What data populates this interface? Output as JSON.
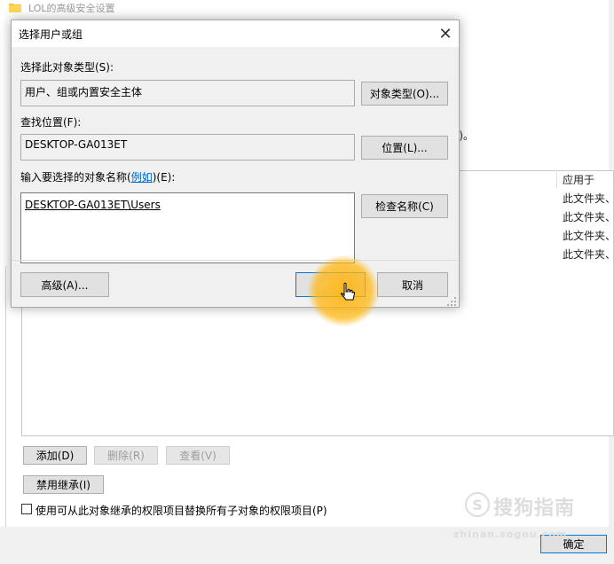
{
  "background_window": {
    "title": "LOL的高级安全设置",
    "fragment_text": "i)。",
    "list_column_header": "应用于",
    "list_rows": [
      "此文件夹、",
      "此文件夹、",
      "此文件夹、",
      "此文件夹、"
    ],
    "buttons": {
      "add": "添加(D)",
      "remove": "删除(R)",
      "view": "查看(V)",
      "disable_inheritance": "禁用继承(I)"
    },
    "replace_checkbox_label": "使用可从此对象继承的权限项目替换所有子对象的权限项目(P)",
    "ok": "确定"
  },
  "dialog": {
    "title": "选择用户或组",
    "close_glyph": "✕",
    "object_type_label": "选择此对象类型(S):",
    "object_type_value": "用户、组或内置安全主体",
    "object_type_button": "对象类型(O)...",
    "location_label": "查找位置(F):",
    "location_value": "DESKTOP-GA013ET",
    "location_button": "位置(L)...",
    "enter_names_label_prefix": "输入要选择的对象名称(",
    "examples_link": "例如",
    "enter_names_label_suffix": ")(E):",
    "names_value": "DESKTOP-GA013ET\\Users",
    "check_names_button": "检查名称(C)",
    "advanced_button": "高级(A)...",
    "ok_button": "确定",
    "cancel_button": "取消"
  },
  "watermark": {
    "brand": "搜狗指南",
    "url": "zhinan.sogou.com"
  },
  "colors": {
    "dialog_bg": "#f0f0f0",
    "button_bg": "#e1e1e1",
    "accent_blue": "#0078d7",
    "link_blue": "#0066cc",
    "click_highlight": "#ffb000"
  }
}
